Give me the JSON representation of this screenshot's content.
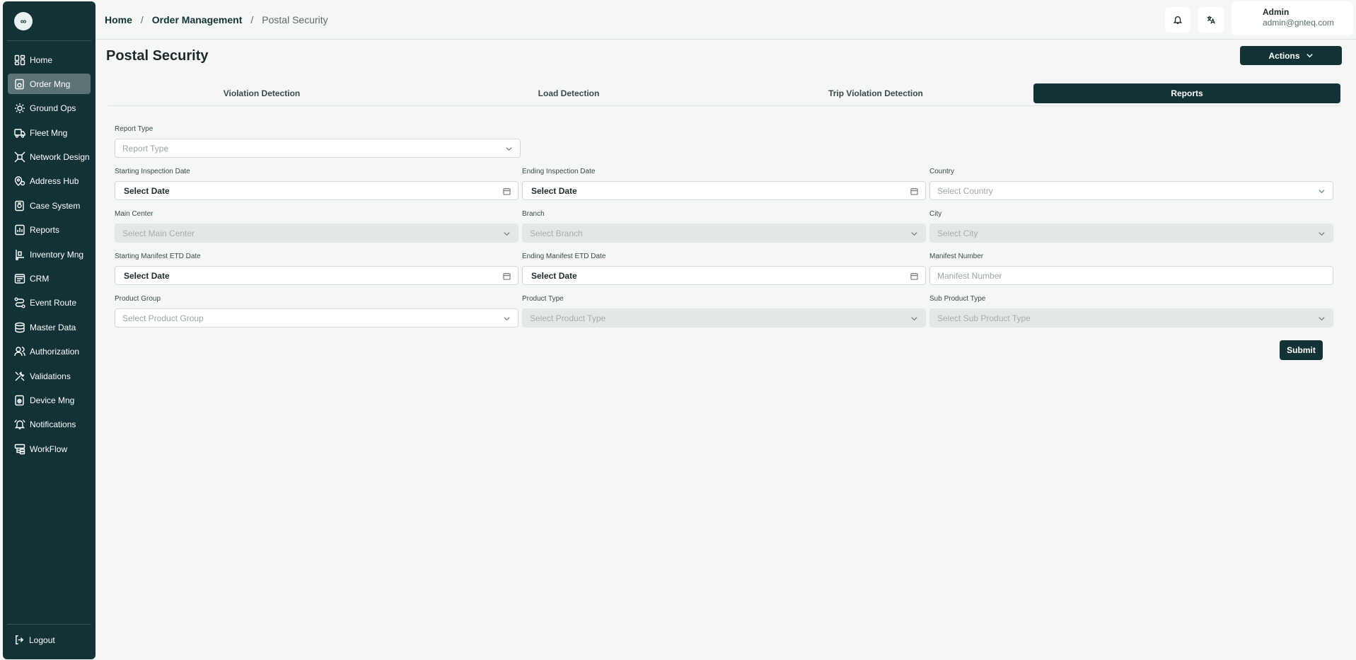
{
  "sidebar": {
    "logo": "∞",
    "items": [
      {
        "label": "Home",
        "icon": "dashboard-icon"
      },
      {
        "label": "Order Mng",
        "icon": "order-icon",
        "active": true
      },
      {
        "label": "Ground Ops",
        "icon": "radar-icon"
      },
      {
        "label": "Fleet Mng",
        "icon": "truck-icon"
      },
      {
        "label": "Network Design",
        "icon": "network-icon"
      },
      {
        "label": "Address Hub",
        "icon": "map-pin-icon"
      },
      {
        "label": "Case System",
        "icon": "case-icon"
      },
      {
        "label": "Reports",
        "icon": "report-icon"
      },
      {
        "label": "Inventory Mng",
        "icon": "inventory-icon"
      },
      {
        "label": "CRM",
        "icon": "crm-icon"
      },
      {
        "label": "Event Route",
        "icon": "route-icon"
      },
      {
        "label": "Master Data",
        "icon": "database-icon"
      },
      {
        "label": "Authorization",
        "icon": "users-icon"
      },
      {
        "label": "Validations",
        "icon": "tools-icon"
      },
      {
        "label": "Device Mng",
        "icon": "device-icon"
      },
      {
        "label": "Notifications",
        "icon": "bell-icon"
      },
      {
        "label": "WorkFlow",
        "icon": "workflow-icon"
      }
    ],
    "logout": "Logout"
  },
  "breadcrumb": {
    "home": "Home",
    "section": "Order Management",
    "current": "Postal Security",
    "separator": "/"
  },
  "user": {
    "name": "Admin",
    "email": "admin@gnteq.com"
  },
  "page": {
    "title": "Postal Security",
    "actions_label": "Actions"
  },
  "tabs": [
    {
      "label": "Violation Detection"
    },
    {
      "label": "Load Detection"
    },
    {
      "label": "Trip Violation Detection"
    },
    {
      "label": "Reports",
      "active": true
    }
  ],
  "form": {
    "report_type": {
      "label": "Report Type",
      "placeholder": "Report Type"
    },
    "start_inspection": {
      "label": "Starting Inspection Date",
      "value": "Select Date"
    },
    "end_inspection": {
      "label": "Ending Inspection Date",
      "value": "Select Date"
    },
    "country": {
      "label": "Country",
      "placeholder": "Select Country"
    },
    "main_center": {
      "label": "Main Center",
      "placeholder": "Select Main Center"
    },
    "branch": {
      "label": "Branch",
      "placeholder": "Select Branch"
    },
    "city": {
      "label": "City",
      "placeholder": "Select City"
    },
    "start_manifest": {
      "label": "Starting Manifest ETD Date",
      "value": "Select Date"
    },
    "end_manifest": {
      "label": "Ending Manifest ETD Date",
      "value": "Select Date"
    },
    "manifest_number": {
      "label": "Manifest Number",
      "placeholder": "Manifest Number"
    },
    "product_group": {
      "label": "Product Group",
      "placeholder": "Select Product Group"
    },
    "product_type": {
      "label": "Product Type",
      "placeholder": "Select Product Type"
    },
    "sub_product_type": {
      "label": "Sub Product Type",
      "placeholder": "Select Sub Product Type"
    },
    "submit_label": "Submit"
  },
  "colors": {
    "primary": "#133235",
    "sidebar_active": "#5b7375",
    "background": "#f4f7f6",
    "disabled": "#e3e8e7"
  }
}
